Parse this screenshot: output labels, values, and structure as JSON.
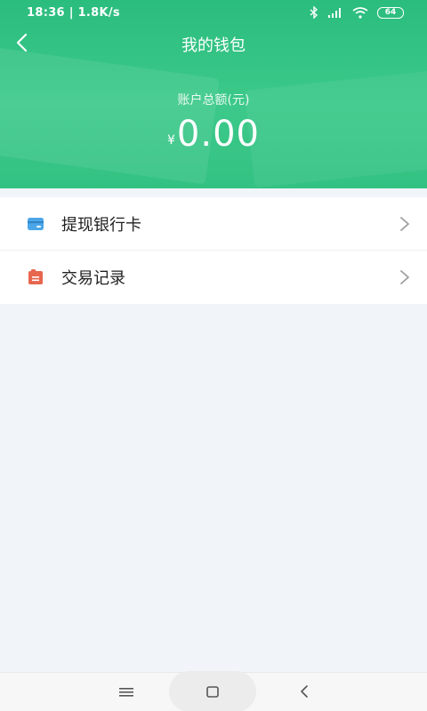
{
  "status_bar": {
    "time_speed": "18:36 | 1.8K/s",
    "battery": "64"
  },
  "nav": {
    "title": "我的钱包"
  },
  "balance": {
    "label": "账户总额(元)",
    "currency": "¥",
    "amount": "0.00"
  },
  "menu": {
    "items": [
      {
        "label": "提现银行卡",
        "icon": "bank-card-icon"
      },
      {
        "label": "交易记录",
        "icon": "transaction-record-icon"
      }
    ]
  },
  "colors": {
    "header_green": "#2bbd7e",
    "background": "#f1f5f9",
    "card_icon_blue": "#4ca7e8",
    "record_icon_red": "#e8664e"
  }
}
